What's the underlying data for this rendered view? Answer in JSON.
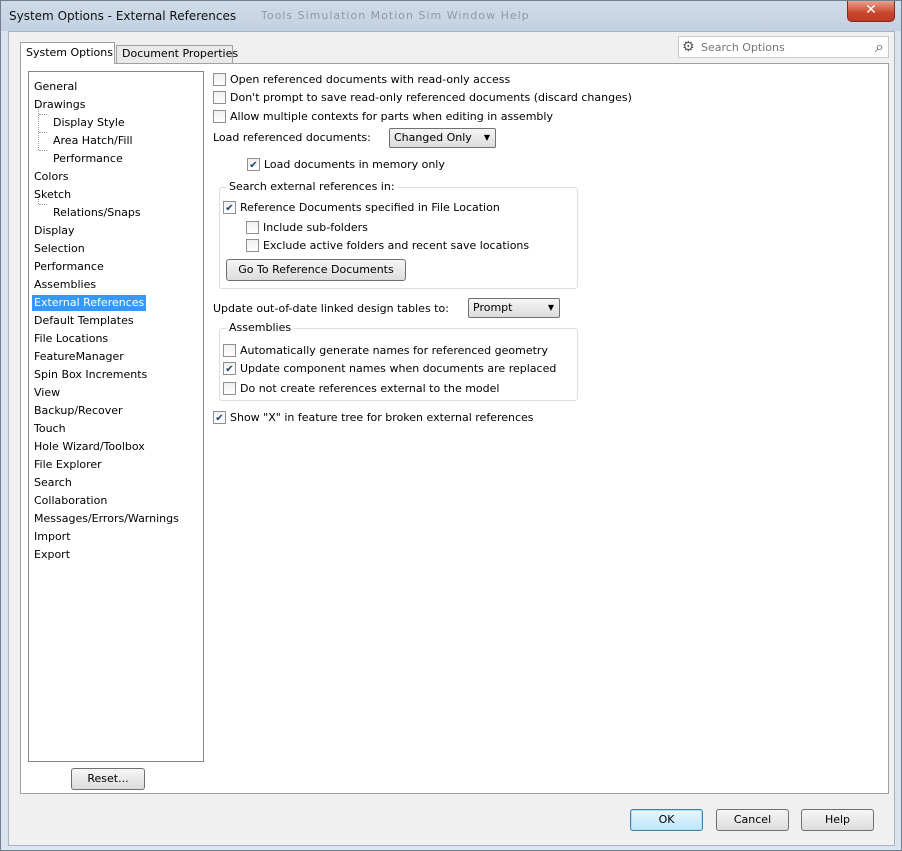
{
  "window": {
    "title": "System Options - External References",
    "background_menu": "Tools    Simulation    Motion Sim    Window    Help",
    "close_glyph": "✕"
  },
  "tabs": [
    {
      "label": "System Options",
      "active": true
    },
    {
      "label": "Document Properties",
      "active": false
    }
  ],
  "search": {
    "placeholder": "Search Options"
  },
  "tree": {
    "items": [
      {
        "label": "General",
        "level": 0
      },
      {
        "label": "Drawings",
        "level": 0
      },
      {
        "label": "Display Style",
        "level": 1
      },
      {
        "label": "Area Hatch/Fill",
        "level": 1
      },
      {
        "label": "Performance",
        "level": 1
      },
      {
        "label": "Colors",
        "level": 0
      },
      {
        "label": "Sketch",
        "level": 0
      },
      {
        "label": "Relations/Snaps",
        "level": 1
      },
      {
        "label": "Display",
        "level": 0
      },
      {
        "label": "Selection",
        "level": 0
      },
      {
        "label": "Performance",
        "level": 0
      },
      {
        "label": "Assemblies",
        "level": 0
      },
      {
        "label": "External References",
        "level": 0,
        "selected": true
      },
      {
        "label": "Default Templates",
        "level": 0
      },
      {
        "label": "File Locations",
        "level": 0
      },
      {
        "label": "FeatureManager",
        "level": 0
      },
      {
        "label": "Spin Box Increments",
        "level": 0
      },
      {
        "label": "View",
        "level": 0
      },
      {
        "label": "Backup/Recover",
        "level": 0
      },
      {
        "label": "Touch",
        "level": 0
      },
      {
        "label": "Hole Wizard/Toolbox",
        "level": 0
      },
      {
        "label": "File Explorer",
        "level": 0
      },
      {
        "label": "Search",
        "level": 0
      },
      {
        "label": "Collaboration",
        "level": 0
      },
      {
        "label": "Messages/Errors/Warnings",
        "level": 0
      },
      {
        "label": "Import",
        "level": 0
      },
      {
        "label": "Export",
        "level": 0
      }
    ]
  },
  "options": {
    "open_read_only": {
      "label": "Open referenced documents with read-only access",
      "checked": false
    },
    "dont_prompt_save": {
      "label": "Don't prompt to save read-only referenced documents (discard changes)",
      "checked": false
    },
    "multiple_contexts": {
      "label": "Allow multiple contexts for parts when editing in assembly",
      "checked": false
    },
    "load_referenced_label": "Load referenced documents:",
    "load_referenced_value": "Changed Only",
    "load_in_memory": {
      "label": "Load documents in memory only",
      "checked": true
    },
    "search_group": {
      "title": "Search external references in:",
      "reference_docs": {
        "label": "Reference Documents specified in File Location",
        "checked": true
      },
      "include_subfolders": {
        "label": "Include sub-folders",
        "checked": false
      },
      "exclude_active": {
        "label": "Exclude active folders and recent save locations",
        "checked": false
      },
      "go_to_button": "Go To Reference Documents"
    },
    "update_tables_label": "Update out-of-date linked design tables to:",
    "update_tables_value": "Prompt",
    "assemblies_group": {
      "title": "Assemblies",
      "auto_names": {
        "label": "Automatically generate names for referenced geometry",
        "checked": false
      },
      "update_names": {
        "label": "Update component names when documents are replaced",
        "checked": true
      },
      "no_external": {
        "label": "Do not create references external to the model",
        "checked": false
      }
    },
    "show_x": {
      "label": "Show \"X\" in feature tree for broken external references",
      "checked": true
    }
  },
  "buttons": {
    "reset": "Reset...",
    "ok": "OK",
    "cancel": "Cancel",
    "help": "Help"
  },
  "icons": {
    "gear": "⚙",
    "search": "⌕",
    "dropdown": "▼"
  }
}
